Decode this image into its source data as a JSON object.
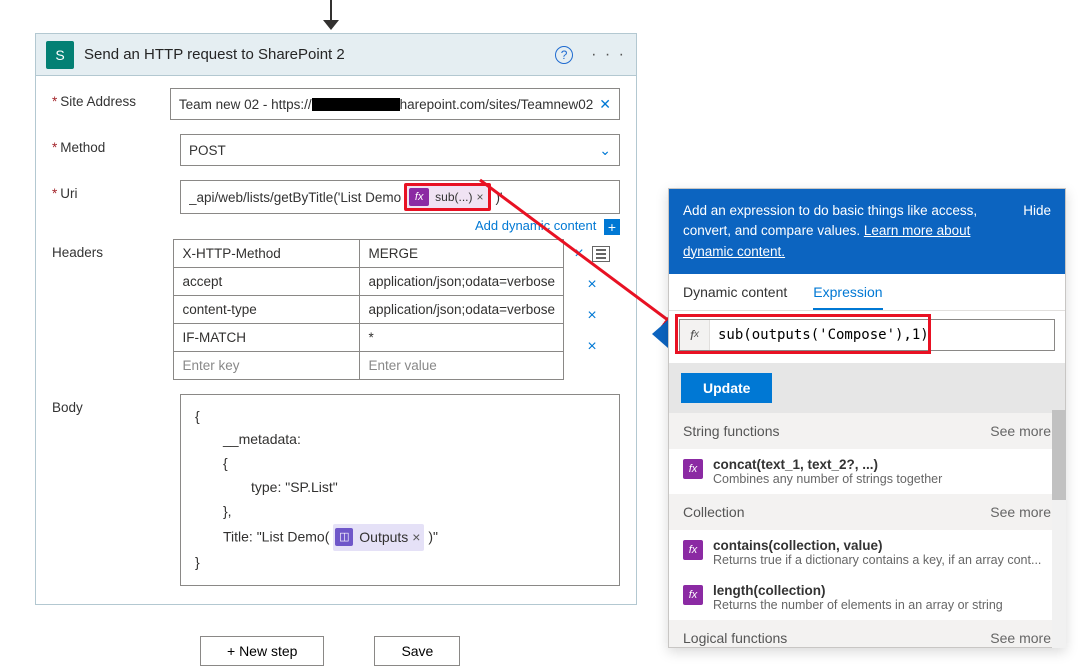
{
  "action": {
    "title": "Send an HTTP request to SharePoint 2",
    "icon_letter": "S",
    "fields": {
      "site_label": "Site Address",
      "site_value_prefix": "Team new 02 - https://",
      "site_value_suffix": "harepoint.com/sites/Teamnew02",
      "method_label": "Method",
      "method_value": "POST",
      "uri_label": "Uri",
      "uri_value_prefix": "_api/web/lists/getByTitle('List Demo",
      "uri_fx_label": "sub(...)",
      "uri_value_suffix": ")'",
      "dyn_content_link": "Add dynamic content",
      "headers_label": "Headers",
      "body_label": "Body"
    },
    "headers": [
      {
        "key": "X-HTTP-Method",
        "value": "MERGE"
      },
      {
        "key": "accept",
        "value": "application/json;odata=verbose"
      },
      {
        "key": "content-type",
        "value": "application/json;odata=verbose"
      },
      {
        "key": "IF-MATCH",
        "value": "*"
      }
    ],
    "headers_placeholder_key": "Enter key",
    "headers_placeholder_value": "Enter value",
    "body": {
      "line_open": "{",
      "metadata_key": "__metadata:",
      "metadata_open": "{",
      "type_line": "type: \"SP.List\"",
      "metadata_close": "},",
      "title_prefix": "Title: \"List Demo(",
      "outputs_pill": "Outputs",
      "title_suffix": ")\"",
      "line_close": "}"
    }
  },
  "footer": {
    "new_step": "+ New step",
    "save": "Save"
  },
  "popup": {
    "intro_msg": "Add an expression to do basic things like access, convert, and compare values. ",
    "learn_more": "Learn more about dynamic content.",
    "hide": "Hide",
    "tab_dynamic": "Dynamic content",
    "tab_expression": "Expression",
    "expression": "sub(outputs('Compose'),1)",
    "update": "Update",
    "sections": {
      "string_title": "String functions",
      "collection_title": "Collection",
      "logical_title": "Logical functions",
      "see_more": "See more"
    },
    "fns": {
      "concat_name": "concat(text_1, text_2?, ...)",
      "concat_desc": "Combines any number of strings together",
      "contains_name": "contains(collection, value)",
      "contains_desc": "Returns true if a dictionary contains a key, if an array cont...",
      "length_name": "length(collection)",
      "length_desc": "Returns the number of elements in an array or string"
    }
  }
}
